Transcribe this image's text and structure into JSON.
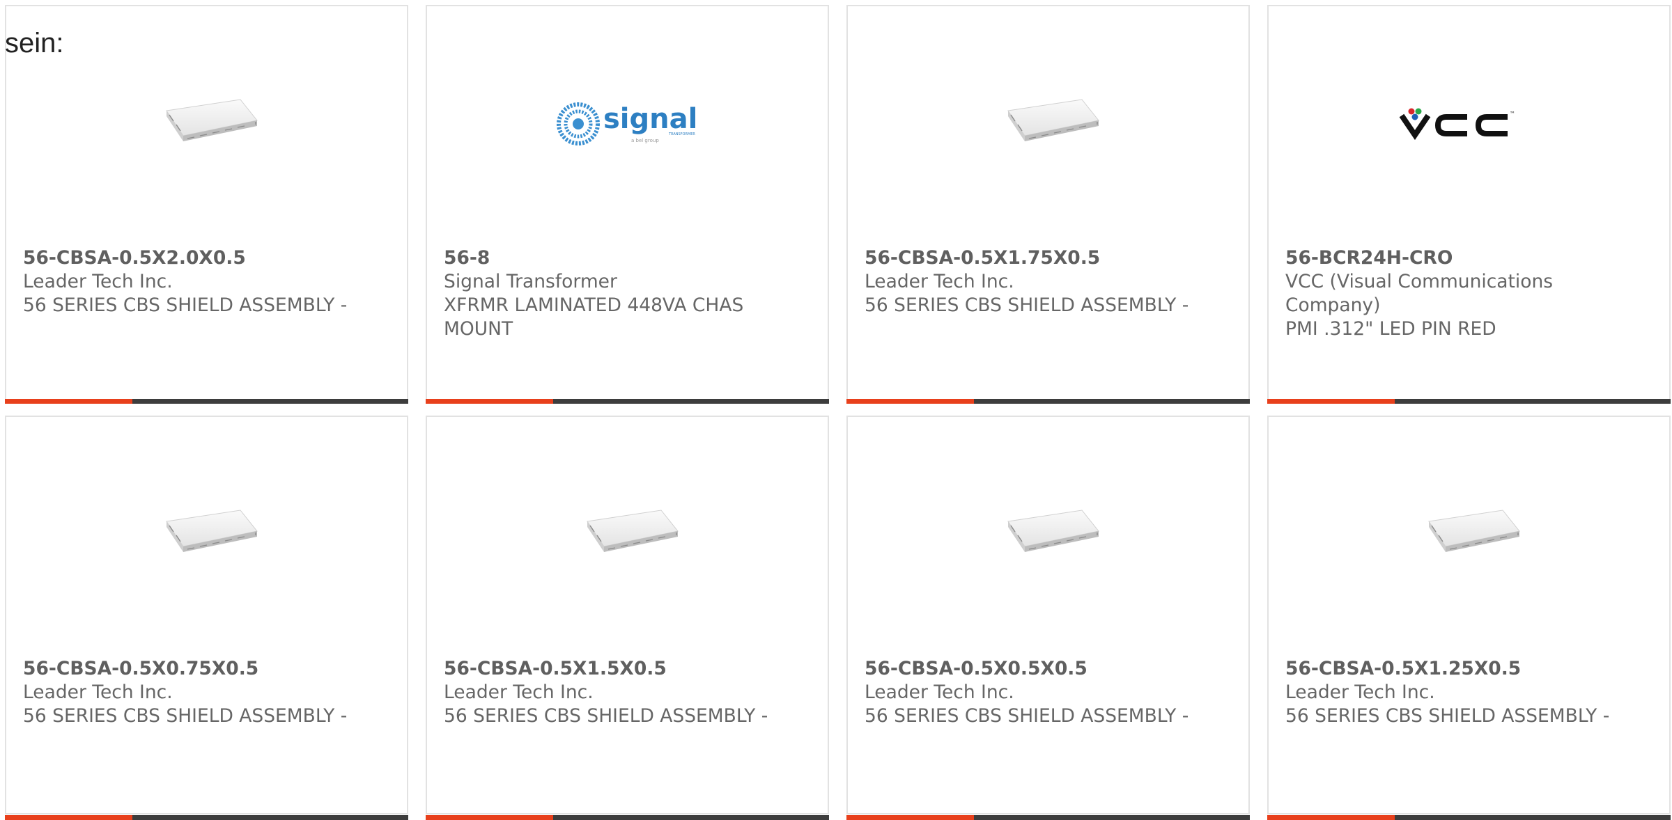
{
  "page_label": "sein:",
  "accent_color": "#e8401c",
  "bar_color": "#3d3d3d",
  "cards": [
    {
      "part": "56-CBSA-0.5X2.0X0.5",
      "maker": "Leader Tech Inc.",
      "desc": "56 SERIES CBS SHIELD ASSEMBLY -",
      "image": "shield-can-image"
    },
    {
      "part": "56-8",
      "maker": "Signal Transformer",
      "desc": "XFRMR LAMINATED 448VA CHAS MOUNT",
      "image": "signal-logo",
      "logo_text": "signal",
      "logo_sub": "TRANSFORMER",
      "logo_tag": "a bel group"
    },
    {
      "part": "56-CBSA-0.5X1.75X0.5",
      "maker": "Leader Tech Inc.",
      "desc": "56 SERIES CBS SHIELD ASSEMBLY -",
      "image": "shield-can-image"
    },
    {
      "part": "56-BCR24H-CRO",
      "maker": "VCC (Visual Communications Company)",
      "desc": "PMI .312\" LED PIN RED",
      "image": "vcc-logo",
      "logo_text": "VCC",
      "logo_tm": "™"
    },
    {
      "part": "56-CBSA-0.5X0.75X0.5",
      "maker": "Leader Tech Inc.",
      "desc": "56 SERIES CBS SHIELD ASSEMBLY -",
      "image": "shield-can-image"
    },
    {
      "part": "56-CBSA-0.5X1.5X0.5",
      "maker": "Leader Tech Inc.",
      "desc": "56 SERIES CBS SHIELD ASSEMBLY -",
      "image": "shield-can-image"
    },
    {
      "part": "56-CBSA-0.5X0.5X0.5",
      "maker": "Leader Tech Inc.",
      "desc": "56 SERIES CBS SHIELD ASSEMBLY -",
      "image": "shield-can-image"
    },
    {
      "part": "56-CBSA-0.5X1.25X0.5",
      "maker": "Leader Tech Inc.",
      "desc": "56 SERIES CBS SHIELD ASSEMBLY -",
      "image": "shield-can-image"
    }
  ]
}
